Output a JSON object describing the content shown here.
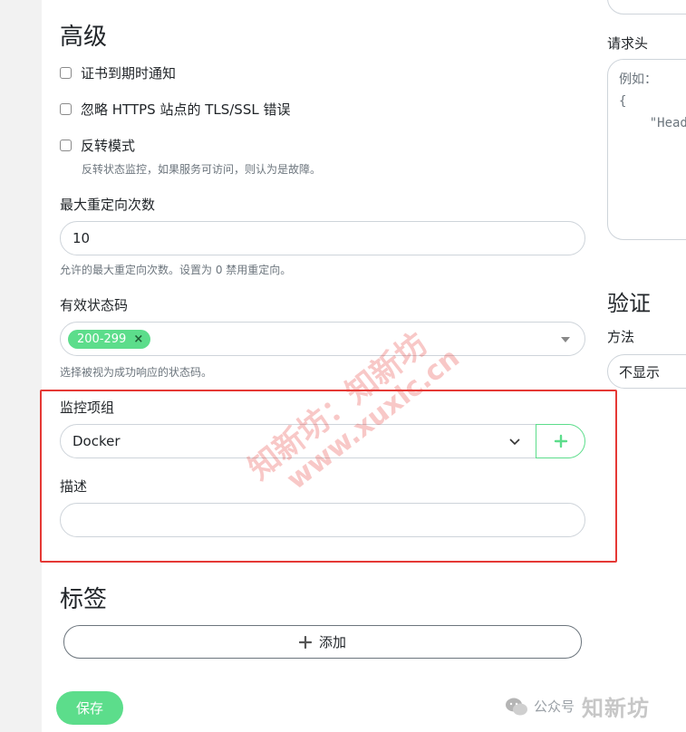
{
  "advanced": {
    "title": "高级",
    "cert_expiry_label": "证书到期时通知",
    "ignore_tls_label": "忽略 HTTPS 站点的 TLS/SSL 错误",
    "reverse_mode_label": "反转模式",
    "reverse_mode_hint": "反转状态监控，如果服务可访问，则认为是故障。",
    "max_redirects_label": "最大重定向次数",
    "max_redirects_value": "10",
    "max_redirects_hint": "允许的最大重定向次数。设置为 0 禁用重定向。",
    "status_codes_label": "有效状态码",
    "status_codes": [
      "200-299"
    ],
    "status_codes_hint": "选择被视为成功响应的状态码。",
    "monitor_group_label": "监控项组",
    "monitor_group_value": "Docker",
    "add_group_icon": "plus-icon",
    "description_label": "描述",
    "description_value": ""
  },
  "tags": {
    "title": "标签",
    "add_label": "添加"
  },
  "save_label": "保存",
  "right": {
    "headers_label": "请求头",
    "headers_placeholder": "例如：\n{\n    \"Header",
    "auth_title": "验证",
    "method_label": "方法",
    "method_value": "不显示"
  },
  "watermark": {
    "line1": "知新坊：知新坊",
    "line2": "www.xuxlc.cn"
  },
  "footer": {
    "account_text": "公众号",
    "brand_text": "知新坊"
  },
  "colors": {
    "accent": "#5cdd8b",
    "highlight_box": "#e53935"
  }
}
